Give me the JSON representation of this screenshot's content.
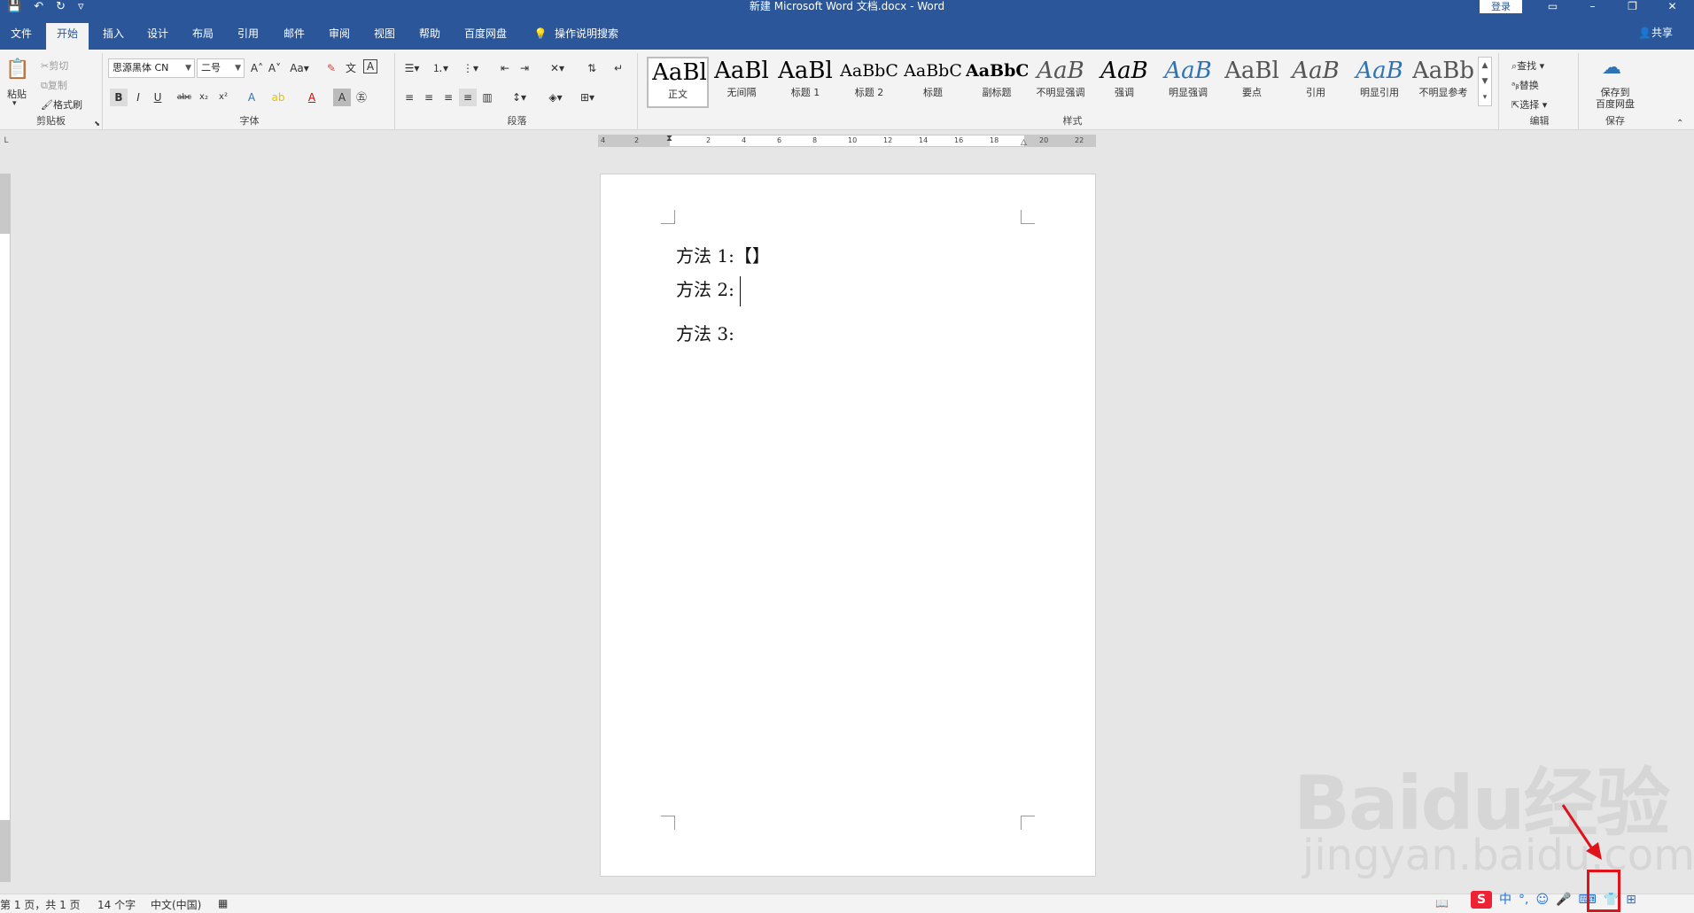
{
  "window": {
    "title": "新建 Microsoft Word 文档.docx  -  Word",
    "login": "登录",
    "share": "共享"
  },
  "qat": [
    "save-icon",
    "undo-icon",
    "redo-icon",
    "customize-icon"
  ],
  "tabs": [
    "文件",
    "开始",
    "插入",
    "设计",
    "布局",
    "引用",
    "邮件",
    "审阅",
    "视图",
    "帮助",
    "百度网盘",
    "操作说明搜索"
  ],
  "clipboard": {
    "paste": "粘贴",
    "cut": "剪切",
    "copy": "复制",
    "format_painter": "格式刷",
    "label": "剪贴板"
  },
  "font": {
    "family": "思源黑体 CN",
    "size": "二号",
    "case": "Aa",
    "label": "字体"
  },
  "paragraph": {
    "label": "段落"
  },
  "styles": {
    "label": "样式",
    "items": [
      {
        "preview": "AaBl",
        "name": "正文"
      },
      {
        "preview": "AaBl",
        "name": "无间隔"
      },
      {
        "preview": "AaBl",
        "name": "标题 1"
      },
      {
        "preview": "AaBbC",
        "name": "标题 2"
      },
      {
        "preview": "AaBbC",
        "name": "标题"
      },
      {
        "preview": "AaBbC",
        "name": "副标题"
      },
      {
        "preview": "AaB",
        "name": "不明显强调"
      },
      {
        "preview": "AaB",
        "name": "强调"
      },
      {
        "preview": "AaB",
        "name": "明显强调"
      },
      {
        "preview": "AaBl",
        "name": "要点"
      },
      {
        "preview": "AaB",
        "name": "引用"
      },
      {
        "preview": "AaB",
        "name": "明显引用"
      },
      {
        "preview": "AaBb",
        "name": "不明显参考"
      }
    ]
  },
  "editing": {
    "find": "查找",
    "replace": "替换",
    "select": "选择",
    "label": "编辑"
  },
  "save_group": {
    "save_to": "保存到",
    "baidu": "百度网盘",
    "label": "保存"
  },
  "ruler": [
    "4",
    "2",
    "2",
    "4",
    "6",
    "8",
    "10",
    "12",
    "14",
    "16",
    "18",
    "20",
    "22"
  ],
  "document": {
    "lines": [
      "方法 1:【】",
      "方法 2:",
      "方法 3:"
    ]
  },
  "status": {
    "page": "第 1 页，共 1 页",
    "words": "14 个字",
    "language": "中文(中国)"
  },
  "ime": {
    "logo": "S",
    "mode": "中"
  },
  "watermark": {
    "line1": "Baidu经验",
    "line2": "jingyan.baidu.com"
  },
  "colors": {
    "brand": "#2b579a",
    "highlight": "#e0121a"
  }
}
